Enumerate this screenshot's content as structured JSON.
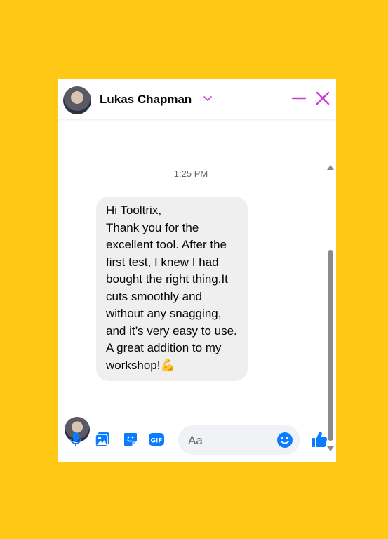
{
  "header": {
    "contact_name": "Lukas Chapman"
  },
  "messages": {
    "timestamp": "1:25 PM",
    "items": [
      {
        "sender": "Lukas Chapman",
        "text": "Hi Tooltrix,\nThank you for the excellent tool. After the first test, I knew I had bought the right thing.It cuts smoothly and without any snagging, and it’s very easy to use. A great addition to my workshop!💪"
      }
    ]
  },
  "composer": {
    "placeholder": "Aa"
  },
  "colors": {
    "page_background": "#FFC814",
    "header_accent": "#C63FD2",
    "messenger_blue": "#0A7CFF",
    "bubble_background": "#EFEFEF"
  },
  "icons": {
    "header": [
      "chevron-down-icon",
      "minimize-icon",
      "close-icon"
    ],
    "composer": [
      "microphone-icon",
      "photo-icon",
      "sticker-icon",
      "gif-icon",
      "emoji-icon",
      "like-icon"
    ]
  }
}
